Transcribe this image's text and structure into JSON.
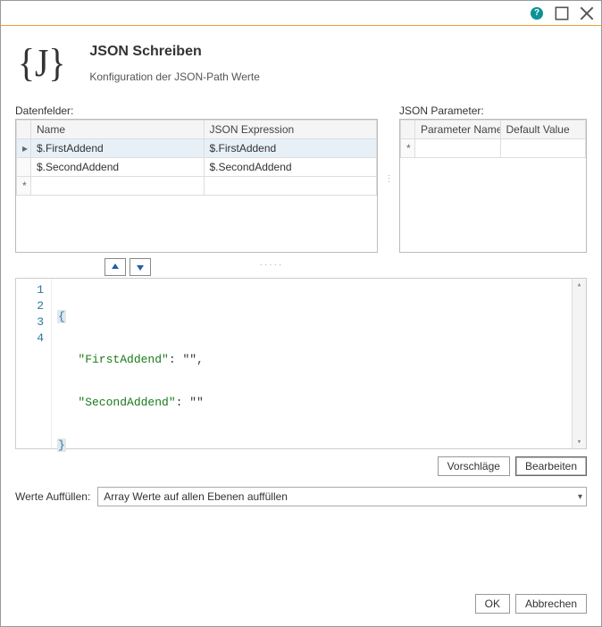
{
  "header": {
    "title": "JSON Schreiben",
    "subtitle": "Konfiguration der JSON-Path Werte",
    "logo": "{J}"
  },
  "datafields": {
    "label": "Datenfelder:",
    "columns": {
      "name": "Name",
      "expr": "JSON Expression"
    },
    "rows": [
      {
        "name": "$.FirstAddend",
        "expr": "$.FirstAddend"
      },
      {
        "name": "$.SecondAddend",
        "expr": "$.SecondAddend"
      }
    ]
  },
  "params": {
    "label": "JSON Parameter:",
    "columns": {
      "name": "Parameter Name",
      "def": "Default Value"
    }
  },
  "editor": {
    "lines": [
      {
        "n": "1",
        "brace": "{"
      },
      {
        "n": "2",
        "key": "\"FirstAddend\"",
        "sep": ": ",
        "val": "\"\"",
        "comma": ","
      },
      {
        "n": "3",
        "key": "\"SecondAddend\"",
        "sep": ": ",
        "val": "\"\"",
        "comma": ""
      },
      {
        "n": "4",
        "brace": "}"
      }
    ]
  },
  "buttons": {
    "suggest": "Vorschläge",
    "edit": "Bearbeiten",
    "ok": "OK",
    "cancel": "Abbrechen"
  },
  "fill": {
    "label": "Werte Auffüllen:",
    "value": "Array Werte auf allen Ebenen auffüllen"
  }
}
